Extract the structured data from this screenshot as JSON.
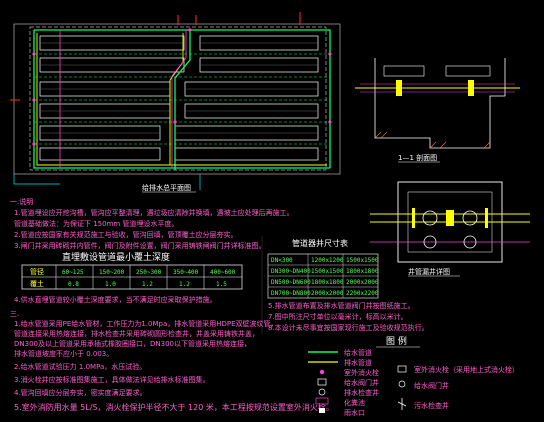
{
  "colors": {
    "background": "#000000",
    "frame": "#ffffff",
    "pipe": "#00ff66",
    "pipe2": "#ffff00",
    "accent": "#ff3fd0",
    "cyan": "#00e5ff",
    "red": "#ff2a2a"
  },
  "plan": {
    "title": "给排水总平面图"
  },
  "section_detail": {
    "caption": "1—1 剖面图",
    "title": "井管漏井详图"
  },
  "notes": {
    "heading": "一.说明",
    "lines": [
      "1.管道埋设应开挖沟槽，管沟应平整清理，遇垃圾应清除并换填，遇坡土应处理后再施工。",
      "  管道基础做法：为保证下 150mm 管道埋设水平度。",
      "2.管道应按国家有关规范施工与验收，管沟回填，管顶覆土应分层夯实。",
      "3.闸门井采用砖砌井内管件，阀门及附件设置，阀门采用铸铁闸阀门井详标准图。"
    ],
    "note4": "4.供水直埋管道较小覆土深度要求，当不满足时应采取保护措施。"
  },
  "cover_table": {
    "title": "直埋敷设管道最小覆土深度",
    "row1": [
      "管径",
      "60~125",
      "150~200",
      "250~300",
      "350~400",
      "400~600"
    ],
    "row2": [
      "覆土",
      "0.8",
      "1.0",
      "1.2",
      "1.2",
      "1.5"
    ]
  },
  "well_table": {
    "title": "管道器井尺寸表",
    "rows": [
      [
        "DN<300",
        "1200x1200",
        "1500x1500"
      ],
      [
        "DN300~DN400",
        "1500x1500",
        "1800x1800"
      ],
      [
        "DN500~DN600",
        "1800x1800",
        "2000x2000"
      ],
      [
        "DN700~DN800",
        "2000x2000",
        "2200x2200"
      ]
    ],
    "notes": [
      "5.排水管道布置及排水管道阀门井按图纸施工。",
      "7.图中所注尺寸单位以毫米计，标高以米计。",
      "8.本设计未尽事宜按国家现行施工及验收规范执行。"
    ]
  },
  "drain_notes": {
    "heading": "三.",
    "lines": [
      "1.给水管道采用PE给水管材，工作压力为1.0Mpa，排水管道采用HDPE双壁波纹管，",
      "  管道连接采用热熔连接，排水检查井采用砖砌圆形检查井，井盖采用铸铁井盖，",
      "  DN300及以上管道采用承插式橡胶圈接口，DN300以下管道采用热熔连接，",
      "  排水管道坡度不应小于 0.003。",
      "2.给水管道试验压力 1.0MPa，水压试验。",
      "3.消火栓井应按标准图集施工，具体做法详见给排水标准图集。",
      "4.管沟回填应分层夯实，密实度满足要求。",
      "5.室外消防用水量 5L/S，消火栓保护半径不大于 120 米，本工程按规范设置室外消火栓。"
    ]
  },
  "legend": {
    "title": "图 例",
    "left_items": [
      "给水管道",
      "排水管道",
      "室外消火栓",
      "给水阀门井",
      "排水检查井",
      "化粪池",
      "雨水口"
    ],
    "right_items": [
      "室外消火栓（采用地上式消火栓）",
      "给水阀门井",
      "污水检查井"
    ]
  }
}
